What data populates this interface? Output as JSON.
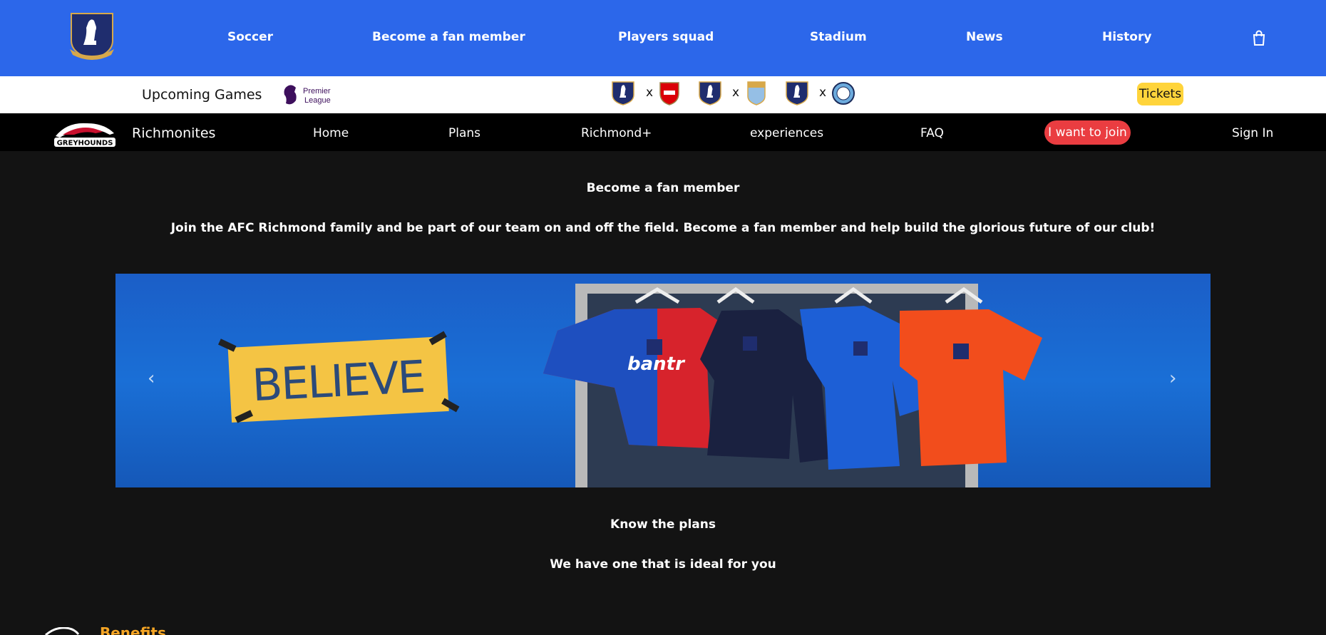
{
  "topnav": {
    "items": [
      "Soccer",
      "Become a fan member",
      "Players squad",
      "Stadium",
      "News",
      "History"
    ]
  },
  "upcoming": {
    "label": "Upcoming Games",
    "league_logo_text": [
      "Premier",
      "League"
    ],
    "tickets_label": "Tickets",
    "vs_symbol": "x"
  },
  "subnav": {
    "brand": "Richmonites",
    "greyhounds_text": "GREYHOUNDS",
    "items": [
      "Home",
      "Plans",
      "Richmond+",
      "experiences",
      "FAQ"
    ],
    "join_label": "I want to join",
    "signin_label": "Sign In"
  },
  "hero": {
    "title": "Become a fan member",
    "subtitle": "Join the AFC Richmond family and be part of our team on and off the field. Become a fan member and help build the glorious future of our club!",
    "banner_sign": "BELIEVE",
    "shirt_sponsor": "bantr",
    "prev_arrow": "‹",
    "next_arrow": "›"
  },
  "plans": {
    "title": "Know the plans",
    "subtitle": "We have one that is ideal for you"
  },
  "benefits": {
    "title": "Benefits"
  },
  "colors": {
    "topnav_bg": "#2c67ea",
    "tickets_bg": "#ffd43b",
    "join_bg": "#ea3d41",
    "page_bg": "#131313",
    "benefits_accent": "#f5a524"
  },
  "icons": [
    "afc-richmond-crest-icon",
    "shopping-bag-icon",
    "premier-league-logo-icon",
    "arsenal-crest-icon",
    "aston-villa-crest-icon",
    "man-city-crest-icon",
    "greyhounds-logo-icon",
    "chevron-left-icon",
    "chevron-right-icon"
  ]
}
